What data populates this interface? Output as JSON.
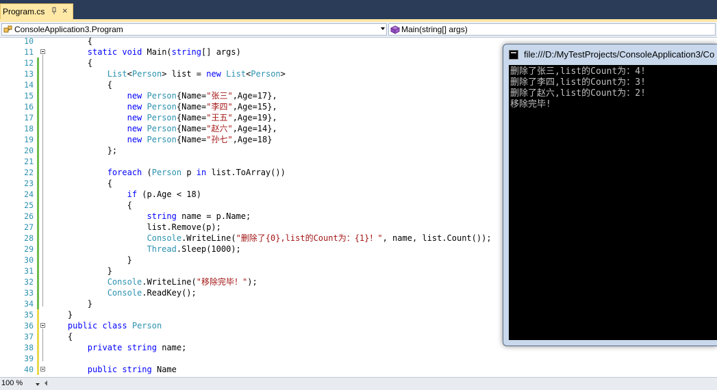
{
  "tab": {
    "label": "Program.cs",
    "close": "×"
  },
  "nav": {
    "class_combo": "ConsoleApplication3.Program",
    "member_combo": "Main(string[] args)"
  },
  "editor": {
    "lines": [
      {
        "n": "10",
        "fold": false,
        "code": [
          {
            "t": "        {"
          }
        ]
      },
      {
        "n": "11",
        "fold": true,
        "code": [
          {
            "t": "        "
          },
          {
            "t": "static",
            "c": "kw"
          },
          {
            "t": " "
          },
          {
            "t": "void",
            "c": "kw"
          },
          {
            "t": " Main("
          },
          {
            "t": "string",
            "c": "kw"
          },
          {
            "t": "[] args)"
          }
        ]
      },
      {
        "n": "12",
        "fold": false,
        "code": [
          {
            "t": "        {"
          }
        ]
      },
      {
        "n": "13",
        "fold": false,
        "code": [
          {
            "t": "            "
          },
          {
            "t": "List",
            "c": "ty"
          },
          {
            "t": "<"
          },
          {
            "t": "Person",
            "c": "ty"
          },
          {
            "t": "> list = "
          },
          {
            "t": "new",
            "c": "kw"
          },
          {
            "t": " "
          },
          {
            "t": "List",
            "c": "ty"
          },
          {
            "t": "<"
          },
          {
            "t": "Person",
            "c": "ty"
          },
          {
            "t": ">"
          }
        ]
      },
      {
        "n": "14",
        "fold": false,
        "code": [
          {
            "t": "            {"
          }
        ]
      },
      {
        "n": "15",
        "fold": false,
        "code": [
          {
            "t": "                "
          },
          {
            "t": "new",
            "c": "kw"
          },
          {
            "t": " "
          },
          {
            "t": "Person",
            "c": "ty"
          },
          {
            "t": "{Name="
          },
          {
            "t": "\"张三\"",
            "c": "str"
          },
          {
            "t": ",Age=17},"
          }
        ]
      },
      {
        "n": "16",
        "fold": false,
        "code": [
          {
            "t": "                "
          },
          {
            "t": "new",
            "c": "kw"
          },
          {
            "t": " "
          },
          {
            "t": "Person",
            "c": "ty"
          },
          {
            "t": "{Name="
          },
          {
            "t": "\"李四\"",
            "c": "str"
          },
          {
            "t": ",Age=15},"
          }
        ]
      },
      {
        "n": "17",
        "fold": false,
        "code": [
          {
            "t": "                "
          },
          {
            "t": "new",
            "c": "kw"
          },
          {
            "t": " "
          },
          {
            "t": "Person",
            "c": "ty"
          },
          {
            "t": "{Name="
          },
          {
            "t": "\"王五\"",
            "c": "str"
          },
          {
            "t": ",Age=19},"
          }
        ]
      },
      {
        "n": "18",
        "fold": false,
        "code": [
          {
            "t": "                "
          },
          {
            "t": "new",
            "c": "kw"
          },
          {
            "t": " "
          },
          {
            "t": "Person",
            "c": "ty"
          },
          {
            "t": "{Name="
          },
          {
            "t": "\"赵六\"",
            "c": "str"
          },
          {
            "t": ",Age=14},"
          }
        ]
      },
      {
        "n": "19",
        "fold": false,
        "code": [
          {
            "t": "                "
          },
          {
            "t": "new",
            "c": "kw"
          },
          {
            "t": " "
          },
          {
            "t": "Person",
            "c": "ty"
          },
          {
            "t": "{Name="
          },
          {
            "t": "\"孙七\"",
            "c": "str"
          },
          {
            "t": ",Age=18}"
          }
        ]
      },
      {
        "n": "20",
        "fold": false,
        "code": [
          {
            "t": "            };"
          }
        ]
      },
      {
        "n": "21",
        "fold": false,
        "code": [
          {
            "t": ""
          }
        ]
      },
      {
        "n": "22",
        "fold": false,
        "code": [
          {
            "t": "            "
          },
          {
            "t": "foreach",
            "c": "kw"
          },
          {
            "t": " ("
          },
          {
            "t": "Person",
            "c": "ty"
          },
          {
            "t": " p "
          },
          {
            "t": "in",
            "c": "kw"
          },
          {
            "t": " list.ToArray())"
          }
        ]
      },
      {
        "n": "23",
        "fold": false,
        "code": [
          {
            "t": "            {"
          }
        ]
      },
      {
        "n": "24",
        "fold": false,
        "code": [
          {
            "t": "                "
          },
          {
            "t": "if",
            "c": "kw"
          },
          {
            "t": " (p.Age < 18)"
          }
        ]
      },
      {
        "n": "25",
        "fold": false,
        "code": [
          {
            "t": "                {"
          }
        ]
      },
      {
        "n": "26",
        "fold": false,
        "code": [
          {
            "t": "                    "
          },
          {
            "t": "string",
            "c": "kw"
          },
          {
            "t": " name = p.Name;"
          }
        ]
      },
      {
        "n": "27",
        "fold": false,
        "code": [
          {
            "t": "                    list.Remove(p);"
          }
        ]
      },
      {
        "n": "28",
        "fold": false,
        "code": [
          {
            "t": "                    "
          },
          {
            "t": "Console",
            "c": "ty"
          },
          {
            "t": ".WriteLine("
          },
          {
            "t": "\"删除了{0},list的Count为：{1}！\"",
            "c": "str"
          },
          {
            "t": ", name, list.Count());"
          }
        ]
      },
      {
        "n": "29",
        "fold": false,
        "code": [
          {
            "t": "                    "
          },
          {
            "t": "Thread",
            "c": "ty"
          },
          {
            "t": ".Sleep(1000);"
          }
        ]
      },
      {
        "n": "30",
        "fold": false,
        "code": [
          {
            "t": "                }"
          }
        ]
      },
      {
        "n": "31",
        "fold": false,
        "code": [
          {
            "t": "            }"
          }
        ]
      },
      {
        "n": "32",
        "fold": false,
        "code": [
          {
            "t": "            "
          },
          {
            "t": "Console",
            "c": "ty"
          },
          {
            "t": ".WriteLine("
          },
          {
            "t": "\"移除完毕！\"",
            "c": "str"
          },
          {
            "t": ");"
          }
        ]
      },
      {
        "n": "33",
        "fold": false,
        "code": [
          {
            "t": "            "
          },
          {
            "t": "Console",
            "c": "ty"
          },
          {
            "t": ".ReadKey();"
          }
        ]
      },
      {
        "n": "34",
        "fold": false,
        "code": [
          {
            "t": "        }"
          }
        ]
      },
      {
        "n": "35",
        "fold": false,
        "code": [
          {
            "t": "    }"
          }
        ]
      },
      {
        "n": "36",
        "fold": true,
        "code": [
          {
            "t": "    "
          },
          {
            "t": "public",
            "c": "kw"
          },
          {
            "t": " "
          },
          {
            "t": "class",
            "c": "kw"
          },
          {
            "t": " "
          },
          {
            "t": "Person",
            "c": "ty"
          }
        ]
      },
      {
        "n": "37",
        "fold": false,
        "code": [
          {
            "t": "    {"
          }
        ]
      },
      {
        "n": "38",
        "fold": false,
        "code": [
          {
            "t": "        "
          },
          {
            "t": "private",
            "c": "kw"
          },
          {
            "t": " "
          },
          {
            "t": "string",
            "c": "kw"
          },
          {
            "t": " name;"
          }
        ]
      },
      {
        "n": "39",
        "fold": false,
        "code": [
          {
            "t": ""
          }
        ]
      },
      {
        "n": "40",
        "fold": true,
        "code": [
          {
            "t": "        "
          },
          {
            "t": "public",
            "c": "kw"
          },
          {
            "t": " "
          },
          {
            "t": "string",
            "c": "kw"
          },
          {
            "t": " Name"
          }
        ]
      }
    ]
  },
  "console": {
    "title": "file:///D:/MyTestProjects/ConsoleApplication3/Co",
    "lines": [
      "删除了张三,list的Count为：4!",
      "删除了李四,list的Count为：3!",
      "删除了赵六,list的Count为：2!",
      "移除完毕!"
    ]
  },
  "status": {
    "zoom": "100 %"
  },
  "colors": {
    "keyword": "#0000ff",
    "type": "#2b91af",
    "string": "#a31515",
    "tab_bg": "#ffe8a6",
    "chrome_dark": "#2b3c59"
  }
}
